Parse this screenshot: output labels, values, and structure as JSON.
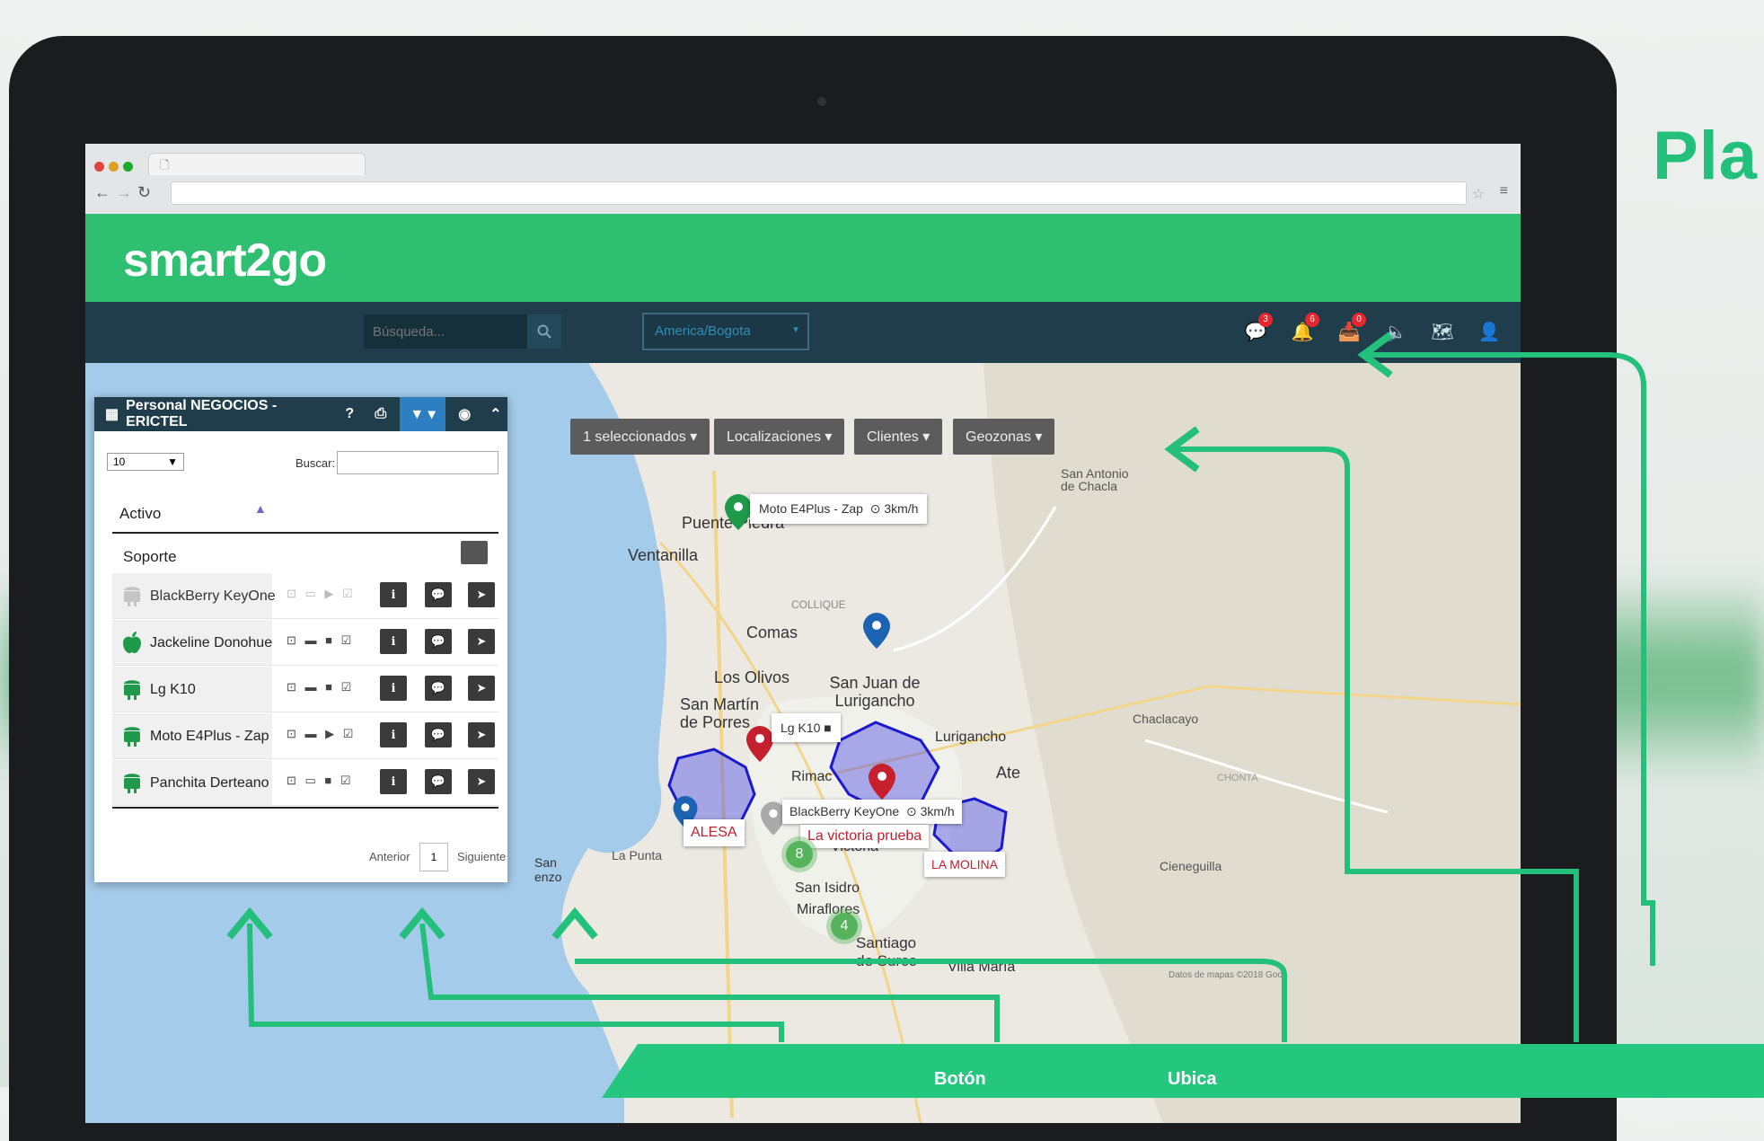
{
  "side_title": "Pla",
  "browser": {
    "tab_title": ""
  },
  "app": {
    "logo": "smart2go"
  },
  "toolbar": {
    "search_placeholder": "Búsqueda...",
    "timezone": "America/Bogota",
    "badges": {
      "chat": "3",
      "alerts": "6",
      "notifications": "0"
    },
    "icons": [
      "chat-icon",
      "bell-icon",
      "inbox-icon",
      "volume-icon",
      "map-icon",
      "user-icon"
    ]
  },
  "map_buttons": [
    {
      "label": "1 seleccionados ▾"
    },
    {
      "label": "Localizaciones ▾"
    },
    {
      "label": "Clientes ▾"
    },
    {
      "label": "Geozonas ▾"
    }
  ],
  "panel": {
    "title": "Personal NEGOCIOS - ERICTEL",
    "page_size": "10",
    "search_label": "Buscar:",
    "column": "Activo",
    "group": "Soporte",
    "rows": [
      {
        "name": "BlackBerry KeyOne",
        "os": "android-grey",
        "status": "⊡ ▭ ▶ ☑"
      },
      {
        "name": "Jackeline Donohue",
        "os": "apple",
        "status": "⊡ ▬ ■ ☑"
      },
      {
        "name": "Lg K10",
        "os": "android",
        "status": "⊡ ▬ ■ ☑"
      },
      {
        "name": "Moto E4Plus - Zap",
        "os": "android",
        "status": "⊡ ▬ ▶ ☑"
      },
      {
        "name": "Panchita Derteano",
        "os": "android",
        "status": "⊡ ▭ ■ ☑"
      }
    ],
    "prev": "Anterior",
    "page": "1",
    "next": "Siguiente"
  },
  "map_labels": {
    "moto": "Moto E4Plus - Zap",
    "moto_speed": "3km/h",
    "lgk10": "Lg K10",
    "blackberry": "BlackBerry KeyOne",
    "blackberry_speed": "3km/h",
    "victoria": "La victoria prueba",
    "alesa": "ALESA",
    "lamolina": "LA MOLINA",
    "cluster_8": "8",
    "cluster_4": "4",
    "attribution": "Datos de mapas ©2018 Goo"
  },
  "places": {
    "puente_piedra": "Puente Piedra",
    "ventanilla": "Ventanilla",
    "comas": "Comas",
    "collique": "COLLIQUE",
    "los_olivos": "Los Olivos",
    "sjl": "San Juan de Lurigancho",
    "san_martin": "San Martín de Porres",
    "rimac": "Rimac",
    "lurigancho": "Lurigancho",
    "ate": "Ate",
    "chaclacayo": "Chaclacayo",
    "san_antonio": "San Antonio de Chacla",
    "la_punta": "La Punta",
    "san_isidro": "San Isidro",
    "miraflores": "Miraflores",
    "surco": "Santiago de Surco",
    "villa_maria": "Villa María",
    "cieneguilla": "Cieneguilla",
    "chontay": "CHONTA",
    "victoria_area": "Victoria",
    "san_lorenzo": "San\nenzo"
  },
  "bottom_bar": {
    "items": [
      "Botón",
      "Ubica",
      ""
    ]
  },
  "colors": {
    "brand": "#2fbf71",
    "navy": "#1f3d4a",
    "accent": "#2d7fc1",
    "alert": "#e8262f"
  }
}
